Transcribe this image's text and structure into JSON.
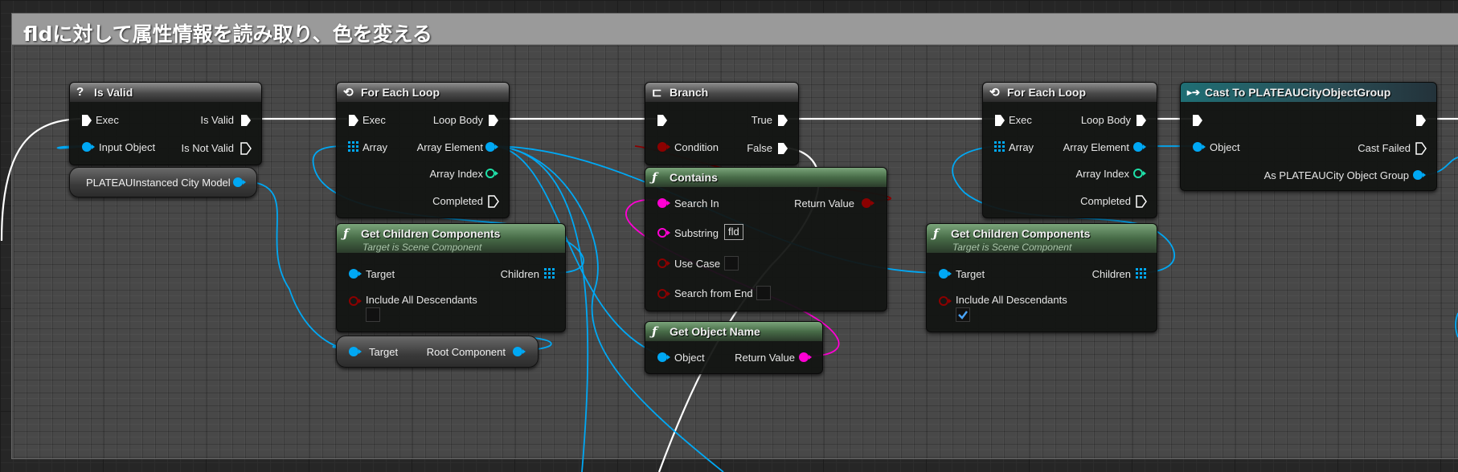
{
  "comment": {
    "title": "fldに対して属性情報を読み取り、色を変える"
  },
  "nodes": {
    "is_valid": {
      "title": "Is Valid",
      "exec": "Exec",
      "is_valid": "Is Valid",
      "input_object": "Input Object",
      "is_not_valid": "Is Not Valid"
    },
    "plateau_var": {
      "label": "PLATEAUInstanced City Model"
    },
    "for_each_1": {
      "title": "For Each Loop",
      "exec": "Exec",
      "loop_body": "Loop Body",
      "array": "Array",
      "array_element": "Array Element",
      "array_index": "Array Index",
      "completed": "Completed"
    },
    "get_children_1": {
      "title": "Get Children Components",
      "subtitle": "Target is Scene Component",
      "target": "Target",
      "children": "Children",
      "include_all": "Include All Descendants",
      "include_all_checked": false
    },
    "root_component": {
      "target": "Target",
      "root": "Root Component"
    },
    "branch": {
      "title": "Branch",
      "true": "True",
      "condition": "Condition",
      "false": "False"
    },
    "contains": {
      "title": "Contains",
      "search_in": "Search In",
      "return_value": "Return Value",
      "substring": "Substring",
      "substring_value": "fld",
      "use_case": "Use Case",
      "search_from_end": "Search from End"
    },
    "get_object_name": {
      "title": "Get Object Name",
      "object": "Object",
      "return_value": "Return Value"
    },
    "for_each_2": {
      "title": "For Each Loop",
      "exec": "Exec",
      "loop_body": "Loop Body",
      "array": "Array",
      "array_element": "Array Element",
      "array_index": "Array Index",
      "completed": "Completed"
    },
    "get_children_2": {
      "title": "Get Children Components",
      "subtitle": "Target is Scene Component",
      "target": "Target",
      "children": "Children",
      "include_all": "Include All Descendants",
      "include_all_checked": true
    },
    "cast": {
      "title": "Cast To PLATEAUCityObjectGroup",
      "object": "Object",
      "cast_failed": "Cast Failed",
      "as_group": "As PLATEAUCity Object Group"
    }
  },
  "colors": {
    "exec": "#ffffff",
    "object": "#00a8f4",
    "bool": "#8c0000",
    "string": "#ff00d4",
    "int": "#1fe0a8",
    "comment_bar": "#9a9a9a"
  }
}
